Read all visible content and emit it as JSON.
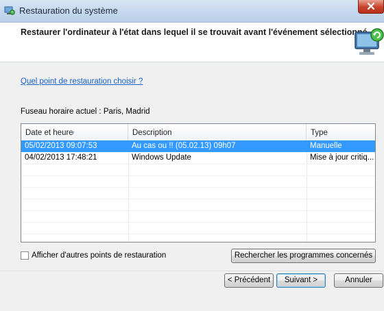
{
  "window": {
    "title": "Restauration du système",
    "title_icon": "system-restore-icon",
    "close_icon": "close-icon"
  },
  "header": {
    "text": "Restaurer l'ordinateur à l'état dans lequel il se trouvait avant l'événement sélectionné",
    "icon": "computer-restore-icon"
  },
  "help_link": "Quel point de restauration choisir ?",
  "timezone": "Fuseau horaire actuel : Paris, Madrid",
  "table": {
    "columns": [
      "Date et heure",
      "Description",
      "Type"
    ],
    "sorted_column": "Date et heure",
    "rows": [
      {
        "date": "05/02/2013 09:07:53",
        "description": "Au cas ou !! (05.02.13) 09h07",
        "type": "Manuelle",
        "selected": true
      },
      {
        "date": "04/02/2013 17:48:21",
        "description": "Windows Update",
        "type": "Mise à jour critiq...",
        "selected": false
      }
    ]
  },
  "show_more_checkbox": {
    "label": "Afficher d'autres points de restauration",
    "checked": false
  },
  "buttons": {
    "scan": "Rechercher les programmes concernés",
    "back": "< Précédent",
    "next": "Suivant >",
    "cancel": "Annuler"
  },
  "colors": {
    "selection": "#3399ff",
    "link": "#1660c8",
    "close_button": "#c7412b"
  }
}
